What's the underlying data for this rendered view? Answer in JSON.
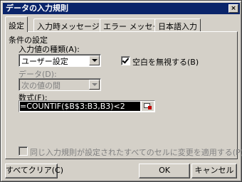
{
  "window": {
    "title": "データの入力規則",
    "close_glyph": "×"
  },
  "tabs": [
    {
      "label": "設定",
      "active": true
    },
    {
      "label": "入力時メッセージ",
      "active": false
    },
    {
      "label": "エラー メッセージ",
      "active": false
    },
    {
      "label": "日本語入力",
      "active": false
    }
  ],
  "settings": {
    "group_title": "条件の設定",
    "allow_label": "入力値の種類(A):",
    "allow_value": "ユーザー設定",
    "ignore_blank_label": "空白を無視する(B)",
    "ignore_blank_checked": true,
    "data_label": "データ(D):",
    "data_value": "次の値の間",
    "formula_label": "数式(F):",
    "formula_value": "=COUNTIF($B$3:B3,B3)<2",
    "apply_all_label": "同じ入力規則が設定されたすべてのセルに変更を適用する(P)",
    "apply_all_checked": false
  },
  "buttons": {
    "clear_all": "すべてクリア(C)",
    "ok": "OK",
    "cancel": "キャンセル"
  }
}
